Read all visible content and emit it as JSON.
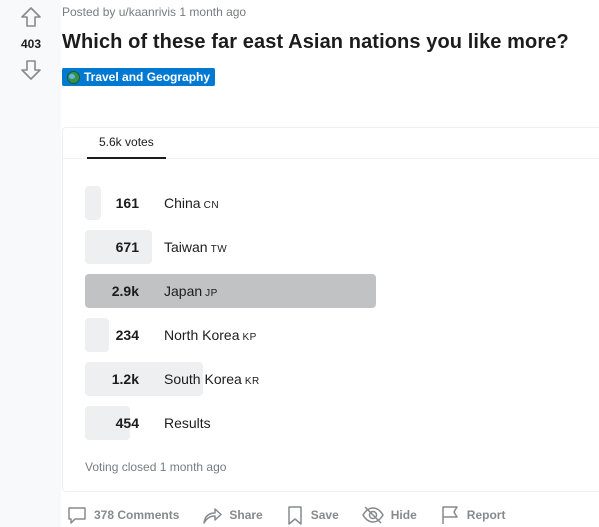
{
  "vote": {
    "score": "403",
    "upvote_icon": "upvote-arrow-icon",
    "downvote_icon": "downvote-arrow-icon"
  },
  "post": {
    "meta": "Posted by u/kaanrivis 1 month ago",
    "title": "Which of these far east Asian nations you like more?",
    "flair": {
      "label": "Travel and Geography",
      "icon": "globe-icon",
      "color": "#0079d3"
    }
  },
  "poll": {
    "tab_label": "5.6k votes",
    "options": [
      {
        "count": "161",
        "label": "China",
        "code": "CN",
        "fraction": 0.029
      },
      {
        "count": "671",
        "label": "Taiwan",
        "code": "TW",
        "fraction": 0.12
      },
      {
        "count": "2.9k",
        "label": "Japan",
        "code": "JP",
        "fraction": 0.52,
        "winner": true
      },
      {
        "count": "234",
        "label": "North Korea",
        "code": "KP",
        "fraction": 0.042
      },
      {
        "count": "1.2k",
        "label": "South Korea",
        "code": "KR",
        "fraction": 0.21
      },
      {
        "count": "454",
        "label": "Results",
        "code": "",
        "fraction": 0.081
      }
    ],
    "status": "Voting closed 1 month ago"
  },
  "actions": {
    "comments": "378 Comments",
    "share": "Share",
    "save": "Save",
    "hide": "Hide",
    "report": "Report"
  },
  "colors": {
    "bar": "#edeff1",
    "winner_bar": "#c0c2c4",
    "action_text": "#878a8c"
  }
}
